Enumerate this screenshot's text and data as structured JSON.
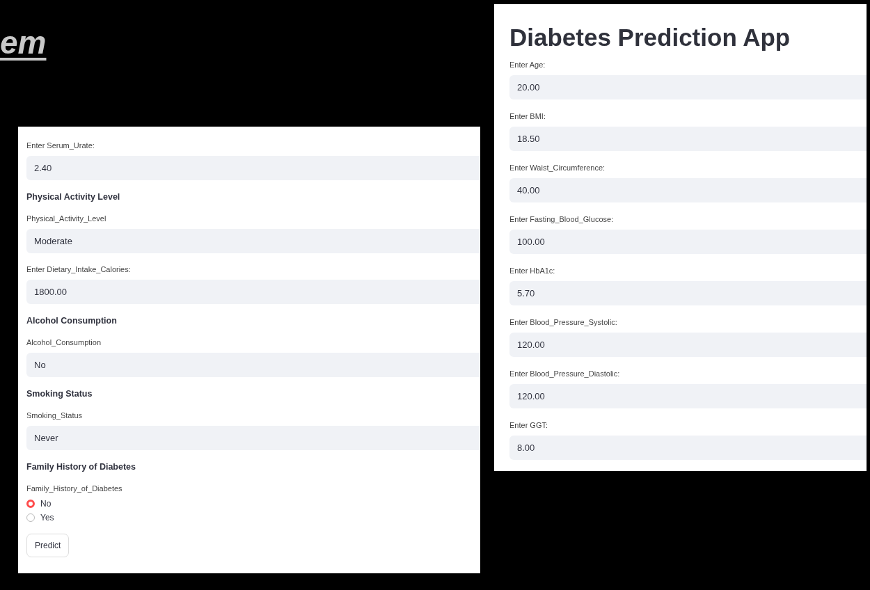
{
  "slide_title": "em",
  "left_panel": {
    "items": [
      {
        "kind": "number",
        "label": "Enter Serum_Urate:",
        "value": "2.40"
      },
      {
        "kind": "select",
        "heading": "Physical Activity Level",
        "label": "Physical_Activity_Level",
        "value": "Moderate"
      },
      {
        "kind": "number",
        "label": "Enter Dietary_Intake_Calories:",
        "value": "1800.00"
      },
      {
        "kind": "select",
        "heading": "Alcohol Consumption",
        "label": "Alcohol_Consumption",
        "value": "No"
      },
      {
        "kind": "select",
        "heading": "Smoking Status",
        "label": "Smoking_Status",
        "value": "Never"
      },
      {
        "kind": "radio",
        "heading": "Family History of Diabetes",
        "label": "Family_History_of_Diabetes",
        "options": [
          {
            "label": "No",
            "selected": true
          },
          {
            "label": "Yes",
            "selected": false
          }
        ]
      }
    ],
    "button": "Predict"
  },
  "right_panel": {
    "title": "Diabetes Prediction App",
    "fields": [
      {
        "label": "Enter Age:",
        "value": "20.00"
      },
      {
        "label": "Enter BMI:",
        "value": "18.50"
      },
      {
        "label": "Enter Waist_Circumference:",
        "value": "40.00"
      },
      {
        "label": "Enter Fasting_Blood_Glucose:",
        "value": "100.00"
      },
      {
        "label": "Enter HbA1c:",
        "value": "5.70"
      },
      {
        "label": "Enter Blood_Pressure_Systolic:",
        "value": "120.00"
      },
      {
        "label": "Enter Blood_Pressure_Diastolic:",
        "value": "120.00"
      },
      {
        "label": "Enter GGT:",
        "value": "8.00"
      }
    ]
  }
}
